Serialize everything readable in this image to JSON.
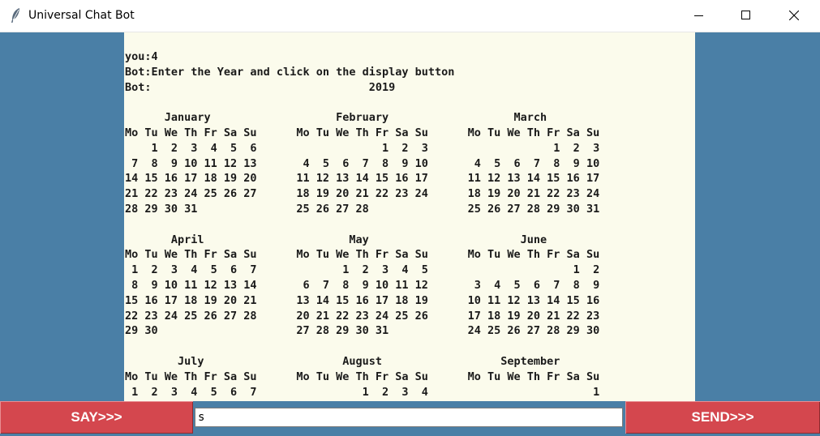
{
  "window": {
    "title": "Universal Chat Bot",
    "app_icon": "feather-icon",
    "controls": [
      "minimize-icon",
      "maximize-icon",
      "close-icon"
    ]
  },
  "chat": {
    "transcript": "you:4\nBot:Enter the Year and click on the display button\nBot:                                 2019\n\n      January                   February                   March\nMo Tu We Th Fr Sa Su      Mo Tu We Th Fr Sa Su      Mo Tu We Th Fr Sa Su\n    1  2  3  4  5  6                   1  2  3                   1  2  3\n 7  8  9 10 11 12 13       4  5  6  7  8  9 10       4  5  6  7  8  9 10\n14 15 16 17 18 19 20      11 12 13 14 15 16 17      11 12 13 14 15 16 17\n21 22 23 24 25 26 27      18 19 20 21 22 23 24      18 19 20 21 22 23 24\n28 29 30 31               25 26 27 28               25 26 27 28 29 30 31\n\n       April                      May                       June\nMo Tu We Th Fr Sa Su      Mo Tu We Th Fr Sa Su      Mo Tu We Th Fr Sa Su\n 1  2  3  4  5  6  7             1  2  3  4  5                      1  2\n 8  9 10 11 12 13 14       6  7  8  9 10 11 12       3  4  5  6  7  8  9\n15 16 17 18 19 20 21      13 14 15 16 17 18 19      10 11 12 13 14 15 16\n22 23 24 25 26 27 28      20 21 22 23 24 25 26      17 18 19 20 21 22 23\n29 30                     27 28 29 30 31            24 25 26 27 28 29 30\n\n        July                     August                  September\nMo Tu We Th Fr Sa Su      Mo Tu We Th Fr Sa Su      Mo Tu We Th Fr Sa Su\n 1  2  3  4  5  6  7                1  2  3  4                         1"
  },
  "controls": {
    "say_label": "SAY>>>",
    "send_label": "SEND>>>",
    "input_value": "s"
  },
  "colors": {
    "background": "#4a7fa6",
    "chat_background": "#fbfbec",
    "button": "#d4474e",
    "button_text": "#ffffff"
  }
}
